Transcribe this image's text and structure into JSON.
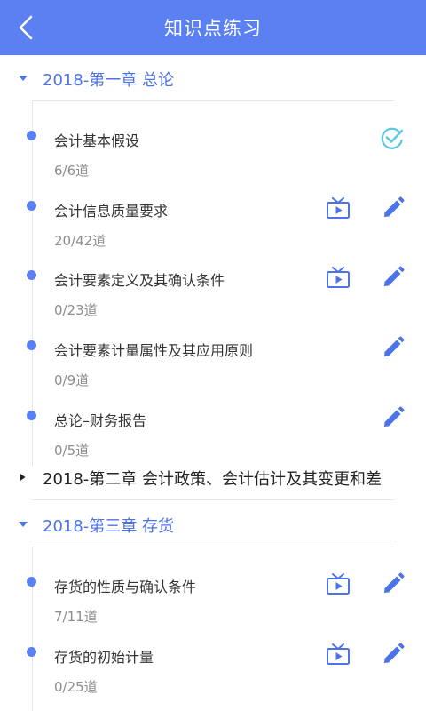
{
  "header": {
    "title": "知识点练习"
  },
  "chapters": [
    {
      "title": "2018-第一章 总论",
      "items": [
        {
          "name": "会计基本假设",
          "count": "6/6道"
        },
        {
          "name": "会计信息质量要求",
          "count": "20/42道"
        },
        {
          "name": "会计要素定义及其确认条件",
          "count": "0/23道"
        },
        {
          "name": "会计要素计量属性及其应用原则",
          "count": "0/9道"
        },
        {
          "name": "总论–财务报告",
          "count": "0/5道"
        }
      ]
    },
    {
      "title": "2018-第二章 会计政策、会计估计及其变更和差"
    },
    {
      "title": "2018-第三章 存货",
      "items": [
        {
          "name": "存货的性质与确认条件",
          "count": "7/11道"
        },
        {
          "name": "存货的初始计量",
          "count": "0/25道"
        }
      ]
    }
  ],
  "colors": {
    "header": "#5b80f2",
    "accent": "#4c73e8",
    "completed_check": "#5ac8e0"
  }
}
